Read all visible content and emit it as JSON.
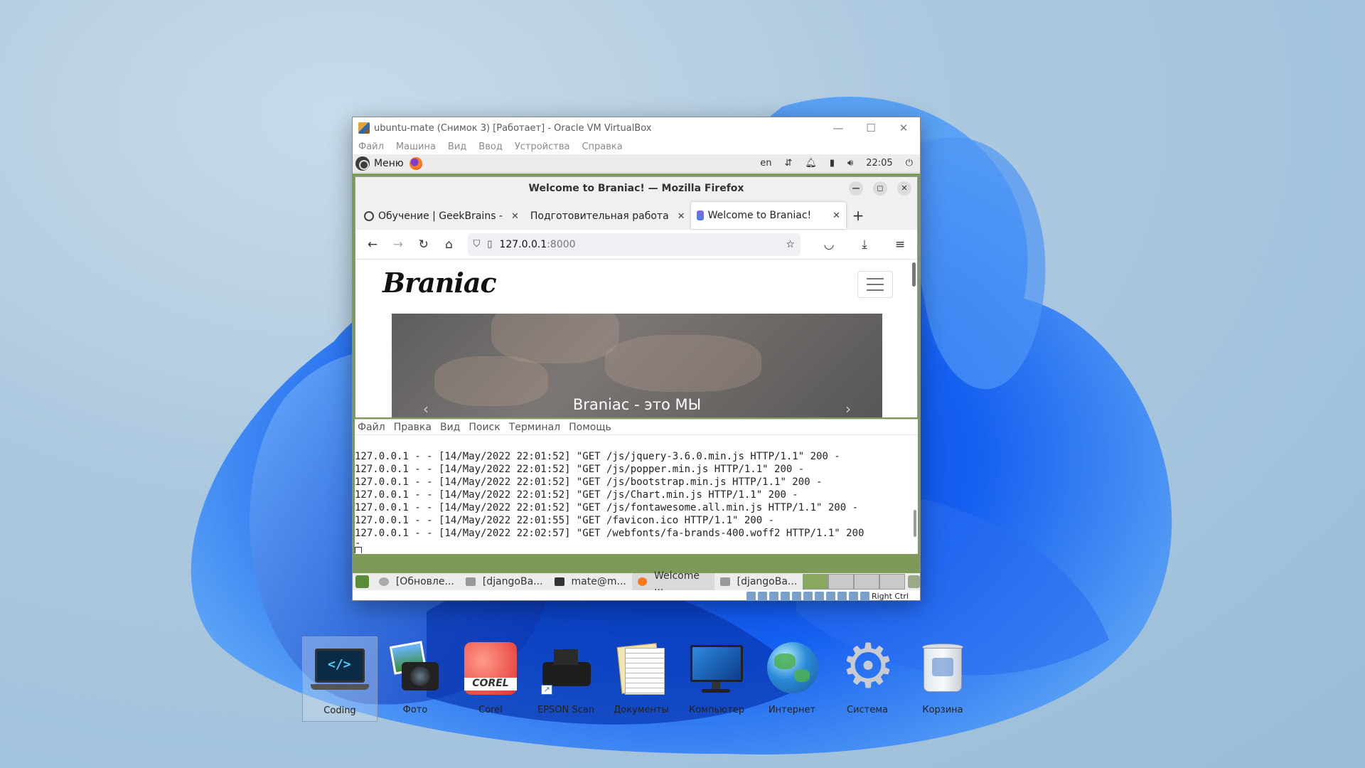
{
  "vbox": {
    "title": "ubuntu-mate (Снимок 3) [Работает] - Oracle VM VirtualBox",
    "menu": [
      "Файл",
      "Машина",
      "Вид",
      "Ввод",
      "Устройства",
      "Справка"
    ],
    "status_host_key": "Right Ctrl"
  },
  "mate_top": {
    "menu_label": "Меню",
    "lang": "en",
    "clock": "22:05"
  },
  "firefox": {
    "window_title": "Welcome to Braniac! — Mozilla Firefox",
    "tabs": [
      {
        "label": "Обучение | GeekBrains -"
      },
      {
        "label": "Подготовительная работа"
      },
      {
        "label": "Welcome to Braniac!"
      }
    ],
    "url_host": "127.0.0.1",
    "url_port": ":8000",
    "brand": "Braniac",
    "hero_caption": "Braniac - это МЫ"
  },
  "terminal": {
    "menu": [
      "Файл",
      "Правка",
      "Вид",
      "Поиск",
      "Терминал",
      "Помощь"
    ],
    "lines": [
      "127.0.0.1 - - [14/May/2022 22:01:52] \"GET /js/jquery-3.6.0.min.js HTTP/1.1\" 200 -",
      "127.0.0.1 - - [14/May/2022 22:01:52] \"GET /js/popper.min.js HTTP/1.1\" 200 -",
      "127.0.0.1 - - [14/May/2022 22:01:52] \"GET /js/bootstrap.min.js HTTP/1.1\" 200 -",
      "127.0.0.1 - - [14/May/2022 22:01:52] \"GET /js/Chart.min.js HTTP/1.1\" 200 -",
      "127.0.0.1 - - [14/May/2022 22:01:52] \"GET /js/fontawesome.all.min.js HTTP/1.1\" 200 -",
      "127.0.0.1 - - [14/May/2022 22:01:55] \"GET /favicon.ico HTTP/1.1\" 200 -",
      "127.0.0.1 - - [14/May/2022 22:02:57] \"GET /webfonts/fa-brands-400.woff2 HTTP/1.1\" 200",
      "-"
    ]
  },
  "mate_bottom": {
    "tasks": [
      "[Обновле...",
      "[djangoBa...",
      "mate@m...",
      "Welcome ...",
      "[djangoBa..."
    ]
  },
  "desktop_icons": [
    {
      "label": "Coding",
      "icon": "laptop-code-icon"
    },
    {
      "label": "Фото",
      "icon": "camera-icon"
    },
    {
      "label": "Corel",
      "icon": "corel-icon"
    },
    {
      "label": "EPSON Scan",
      "icon": "printer-icon"
    },
    {
      "label": "Документы",
      "icon": "documents-icon"
    },
    {
      "label": "Компьютер",
      "icon": "monitor-icon"
    },
    {
      "label": "Интернет",
      "icon": "globe-icon"
    },
    {
      "label": "Система",
      "icon": "gear-icon"
    },
    {
      "label": "Корзина",
      "icon": "recycle-bin-icon"
    }
  ]
}
